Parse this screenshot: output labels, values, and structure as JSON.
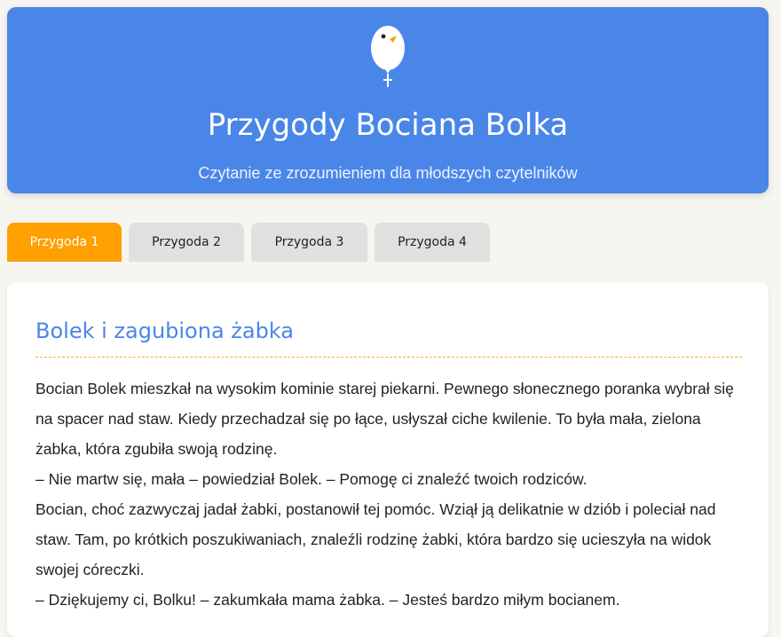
{
  "header": {
    "title": "Przygody Bociana Bolka",
    "subtitle": "Czytanie ze zrozumieniem dla młodszych czytelników",
    "logo_icon": "balloon-stork-icon",
    "background_color": "#4a86e8"
  },
  "tabs": [
    {
      "label": "Przygoda 1",
      "active": true
    },
    {
      "label": "Przygoda 2",
      "active": false
    },
    {
      "label": "Przygoda 3",
      "active": false
    },
    {
      "label": "Przygoda 4",
      "active": false
    }
  ],
  "accent_color": "#ff9f00",
  "story": {
    "title": "Bolek i zagubiona żabka",
    "paragraphs": [
      "Bocian Bolek mieszkał na wysokim kominie starej piekarni. Pewnego słonecznego poranka wybrał się na spacer nad staw. Kiedy przechadzał się po łące, usłyszał ciche kwilenie. To była mała, zielona żabka, która zgubiła swoją rodzinę.",
      "– Nie martw się, mała – powiedział Bolek. – Pomogę ci znaleźć twoich rodziców.",
      "Bocian, choć zazwyczaj jadał żabki, postanowił tej pomóc. Wziął ją delikatnie w dziób i poleciał nad staw. Tam, po krótkich poszukiwaniach, znaleźli rodzinę żabki, która bardzo się ucieszyła na widok swojej córeczki.",
      "– Dziękujemy ci, Bolku! – zakumkała mama żabka. – Jesteś bardzo miłym bocianem."
    ]
  }
}
